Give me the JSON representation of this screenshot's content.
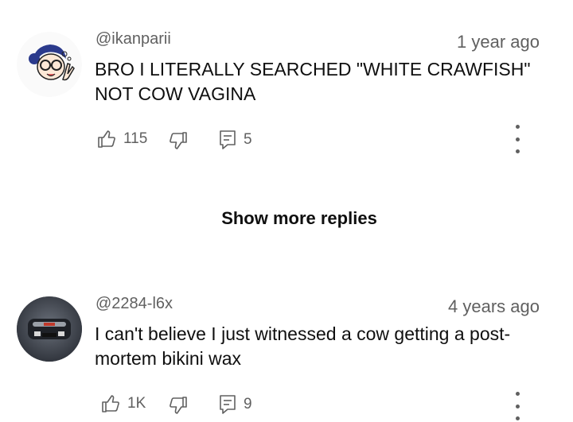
{
  "comments": [
    {
      "handle": "@ikanparii",
      "timestamp": "1 year ago",
      "body": "BRO I LITERALLY SEARCHED \"WHITE CRAWFISH\" NOT COW VAGINA",
      "like_count": "115",
      "reply_count": "5"
    },
    {
      "handle": "@2284-l6x",
      "timestamp": "4 years ago",
      "body": "I can't believe I just witnessed a cow getting a post-mortem bikini wax",
      "like_count": "1K",
      "reply_count": "9"
    }
  ],
  "show_more_replies": "Show more replies",
  "icons": {
    "like": "thumbs-up-icon",
    "dislike": "thumbs-down-icon",
    "reply": "reply-icon",
    "more": "more-vert-icon"
  }
}
